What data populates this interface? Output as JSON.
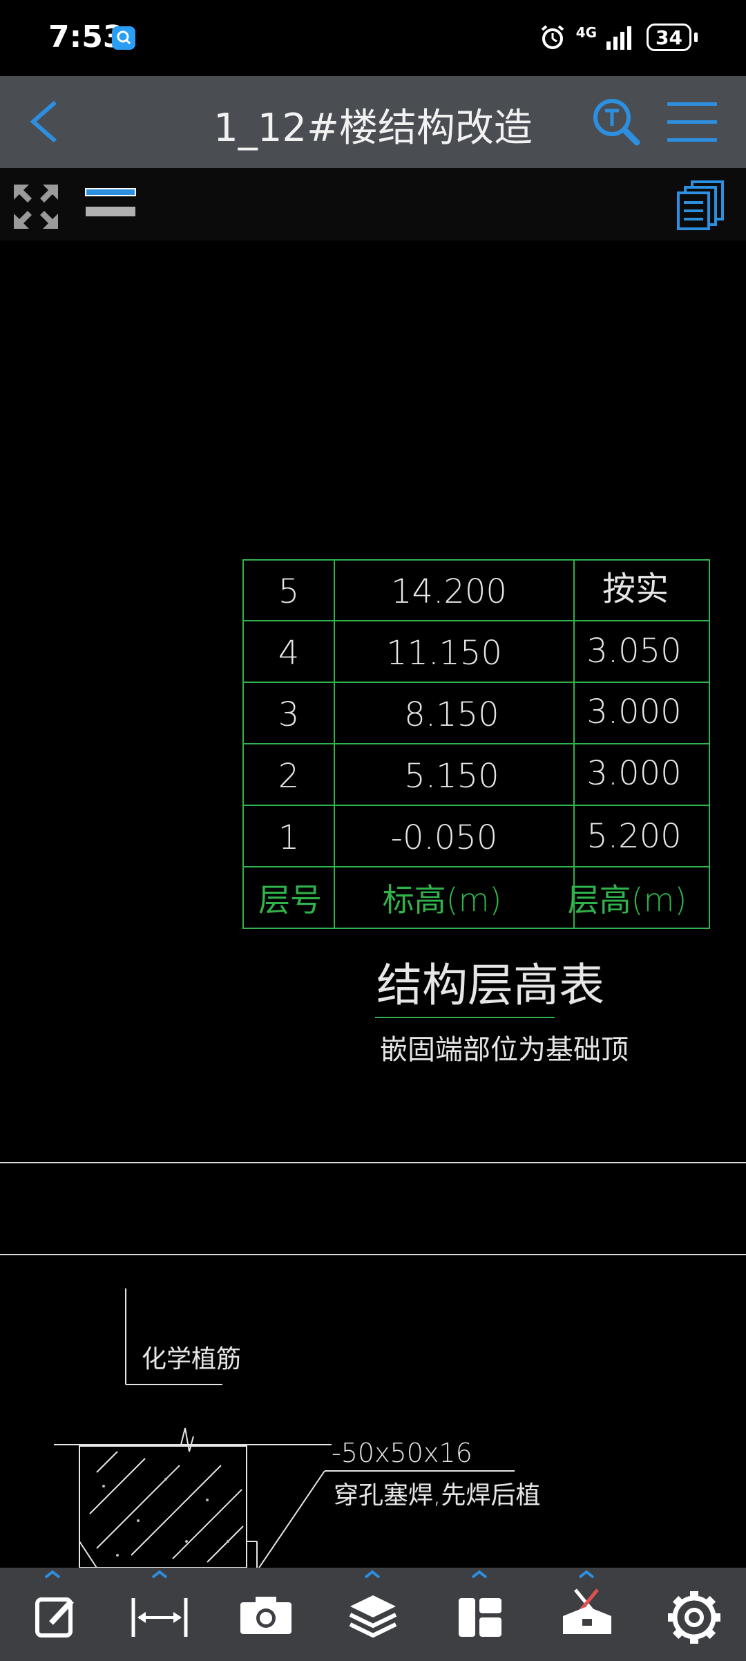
{
  "status": {
    "time": "7:53",
    "network": "4G",
    "battery": "34"
  },
  "header": {
    "title": "1_12#楼结构改造"
  },
  "icons": {
    "back": "chevron-left-icon",
    "text_search": "text-search-icon",
    "menu": "hamburger-menu-icon",
    "expand": "expand-arrows-icon",
    "lineweight": "lineweight-icon",
    "documents": "documents-icon"
  },
  "colors": {
    "accent": "#2d8fe0",
    "cad_green": "#2fb34a",
    "cad_white": "#e6e6e6"
  },
  "drawing": {
    "table": {
      "rows": [
        {
          "floor": "5",
          "elevation": "14.200",
          "height": "按实"
        },
        {
          "floor": "4",
          "elevation": "11.150",
          "height": "3.050"
        },
        {
          "floor": "3",
          "elevation": "8.150",
          "height": "3.000"
        },
        {
          "floor": "2",
          "elevation": "5.150",
          "height": "3.000"
        },
        {
          "floor": "1",
          "elevation": "-0.050",
          "height": "5.200"
        }
      ],
      "header": {
        "floor": "层号",
        "elevation": "标高(m)",
        "height": "层高(m)"
      }
    },
    "table_title": "结构层高表",
    "table_note": "嵌固端部位为基础顶",
    "detail": {
      "label_rebar": "化学植筋",
      "label_plate": "-50x50x16",
      "label_weld": "穿孔塞焊,先焊后植"
    }
  },
  "bottom_toolbar": [
    {
      "name": "annotate-tool",
      "icon": "edit-icon"
    },
    {
      "name": "measure-tool",
      "icon": "measure-icon"
    },
    {
      "name": "camera-tool",
      "icon": "camera-icon"
    },
    {
      "name": "layers-tool",
      "icon": "layers-icon"
    },
    {
      "name": "layout-tool",
      "icon": "layout-icon"
    },
    {
      "name": "toolbox-tool",
      "icon": "toolbox-icon"
    },
    {
      "name": "settings-tool",
      "icon": "gear-icon"
    }
  ]
}
